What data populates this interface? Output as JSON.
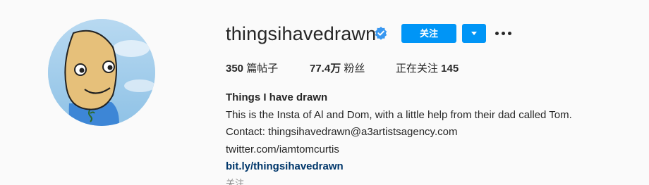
{
  "profile": {
    "username": "thingsihavedrawn",
    "verified_icon": "verified-badge-icon",
    "follow_label": "关注",
    "dropdown_icon": "caret-down-icon",
    "more_icon": "more-options-icon",
    "accent_color": "#0095f6",
    "verified_color": "#3897f0"
  },
  "stats": {
    "posts_count": "350",
    "posts_label": " 篇帖子",
    "followers_count": "77.4万",
    "followers_label": " 粉丝",
    "following_label": "正在关注 ",
    "following_count": "145"
  },
  "bio": {
    "full_name": "Things I have drawn",
    "description": "This is the Insta of Al and Dom, with a little help from their dad called Tom.",
    "contact": "Contact: thingsihavedrawn@a3artistsagency.com",
    "twitter": "twitter.com/iamtomcurtis",
    "website": "bit.ly/thingsihavedrawn"
  },
  "truncated_line": "关注…"
}
